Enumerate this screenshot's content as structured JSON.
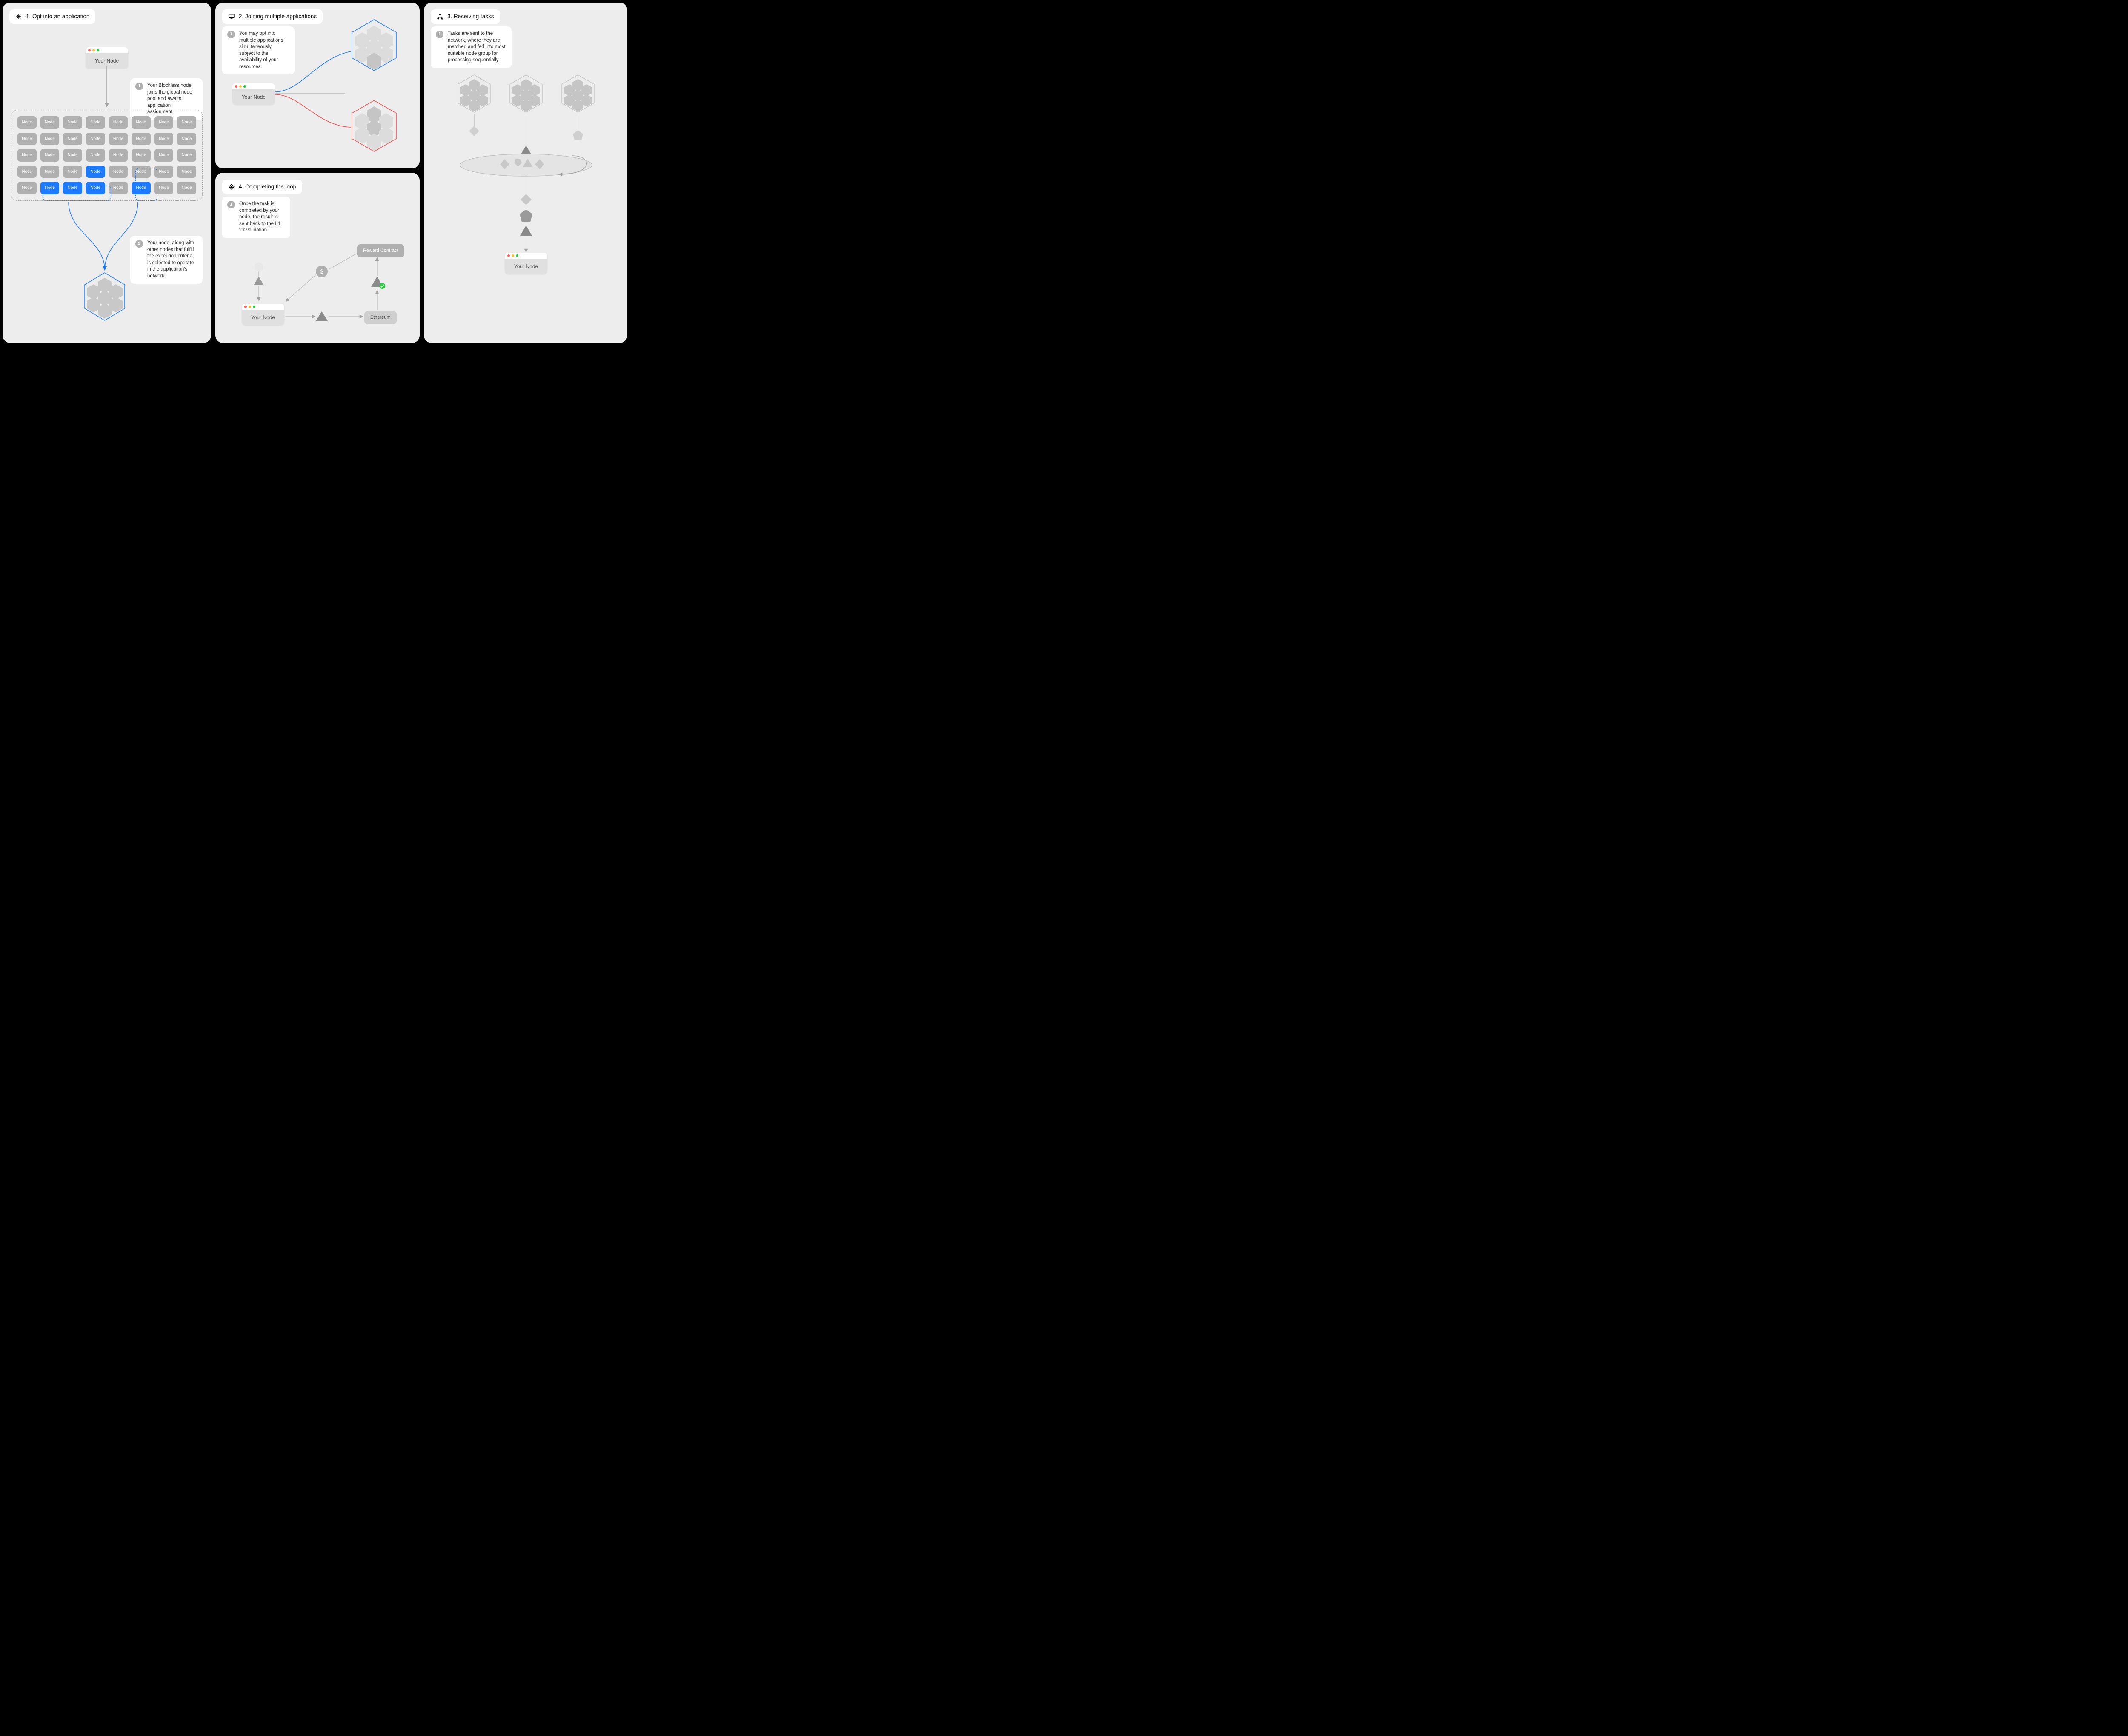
{
  "panels": {
    "p1": {
      "title": "1. Opt into an application"
    },
    "p2": {
      "title": "2. Joining multiple applications"
    },
    "p3": {
      "title": "3. Receiving tasks"
    },
    "p4": {
      "title": "4. Completing the loop"
    }
  },
  "your_node_label": "Your Node",
  "callouts": {
    "p1a": {
      "n": "1",
      "text": "Your Blockless node joins the global node pool and awaits application assignment."
    },
    "p1b": {
      "n": "2",
      "text": "Your node, along with other nodes that fulfill the execution criteria, is selected to operate in the application's network."
    },
    "p2a": {
      "n": "1",
      "text": "You may opt into multiple applications simultaneously, subject to the availability of your resources."
    },
    "p3a": {
      "n": "1",
      "text": "Tasks are sent to the network, where they are matched and fed into most suitable node group for processing sequentially."
    },
    "p4a": {
      "n": "1",
      "text": "Once the task is completed by your node, the result is sent back to the L1 for validation."
    }
  },
  "pool": {
    "node_label": "Node",
    "rows": 5,
    "cols": 8,
    "selected_indices": [
      27,
      33,
      34,
      35,
      37
    ]
  },
  "labels": {
    "reward_contract": "Reward Contract",
    "ethereum": "Ethereum",
    "dollar": "$"
  },
  "colors": {
    "blue": "#1e7bff",
    "red": "#f04d4d",
    "grey": "#b0b0b0"
  }
}
